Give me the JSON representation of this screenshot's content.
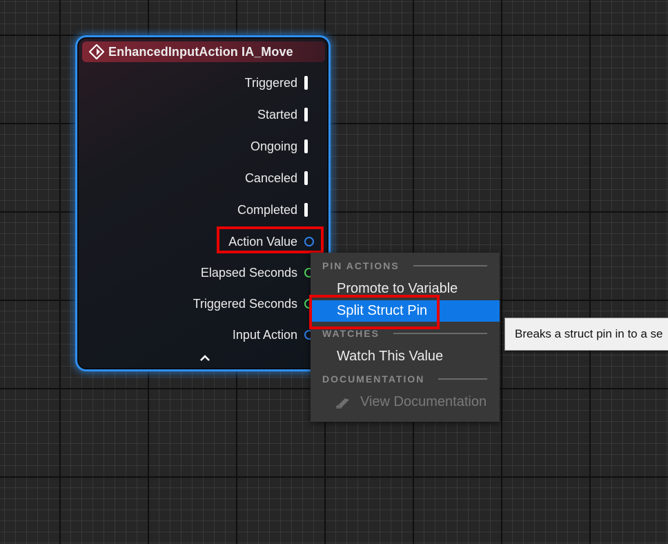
{
  "node": {
    "title": "EnhancedInputAction IA_Move",
    "header_color": "#7e2634",
    "border_color": "#2f8ff0",
    "exec_pins": [
      {
        "label": "Triggered"
      },
      {
        "label": "Started"
      },
      {
        "label": "Ongoing"
      },
      {
        "label": "Canceled"
      },
      {
        "label": "Completed"
      }
    ],
    "data_pins": [
      {
        "label": "Action Value",
        "color": "blue"
      },
      {
        "label": "Elapsed Seconds",
        "color": "green"
      },
      {
        "label": "Triggered Seconds",
        "color": "green"
      },
      {
        "label": "Input Action",
        "color": "blue"
      }
    ],
    "event_icon": "event-diamond-icon",
    "collapse_icon": "chevron-up-icon"
  },
  "context_menu": {
    "sections": [
      {
        "heading": "PIN ACTIONS",
        "items": [
          {
            "label": "Promote to Variable",
            "state": "normal"
          },
          {
            "label": "Split Struct Pin",
            "state": "selected"
          }
        ]
      },
      {
        "heading": "WATCHES",
        "items": [
          {
            "label": "Watch This Value",
            "state": "normal"
          }
        ]
      },
      {
        "heading": "DOCUMENTATION",
        "items": [
          {
            "label": "View Documentation",
            "state": "disabled",
            "icon": "documentation-icon"
          }
        ]
      }
    ],
    "selected_color": "#0f78e6"
  },
  "tooltip": {
    "text": "Breaks a struct pin in to a se"
  },
  "highlight_color": "#e60000"
}
